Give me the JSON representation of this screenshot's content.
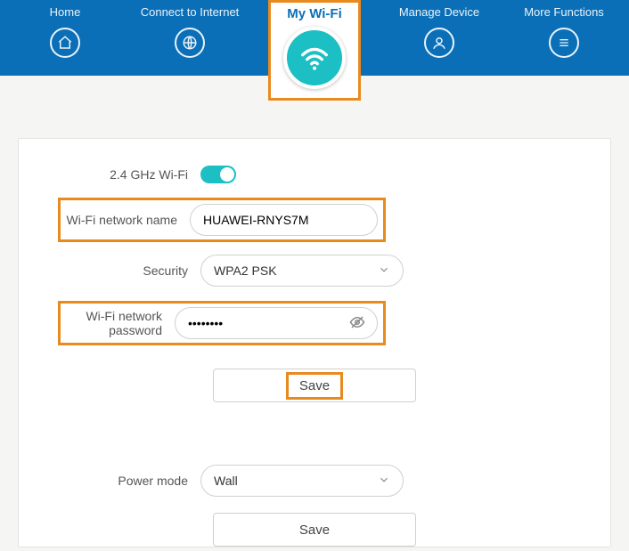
{
  "nav": {
    "home": "Home",
    "connect": "Connect to Internet",
    "mywifi": "My Wi-Fi",
    "manage": "Manage Device",
    "more": "More Functions"
  },
  "form": {
    "enable24_label": "2.4 GHz Wi-Fi",
    "ssid_label": "Wi-Fi network name",
    "ssid_value": "HUAWEI-RNYS7M",
    "security_label": "Security",
    "security_value": "WPA2 PSK",
    "pwd_label": "Wi-Fi network password",
    "pwd_value": "••••••••",
    "save": "Save",
    "powermode_label": "Power mode",
    "powermode_value": "Wall",
    "save2": "Save"
  }
}
